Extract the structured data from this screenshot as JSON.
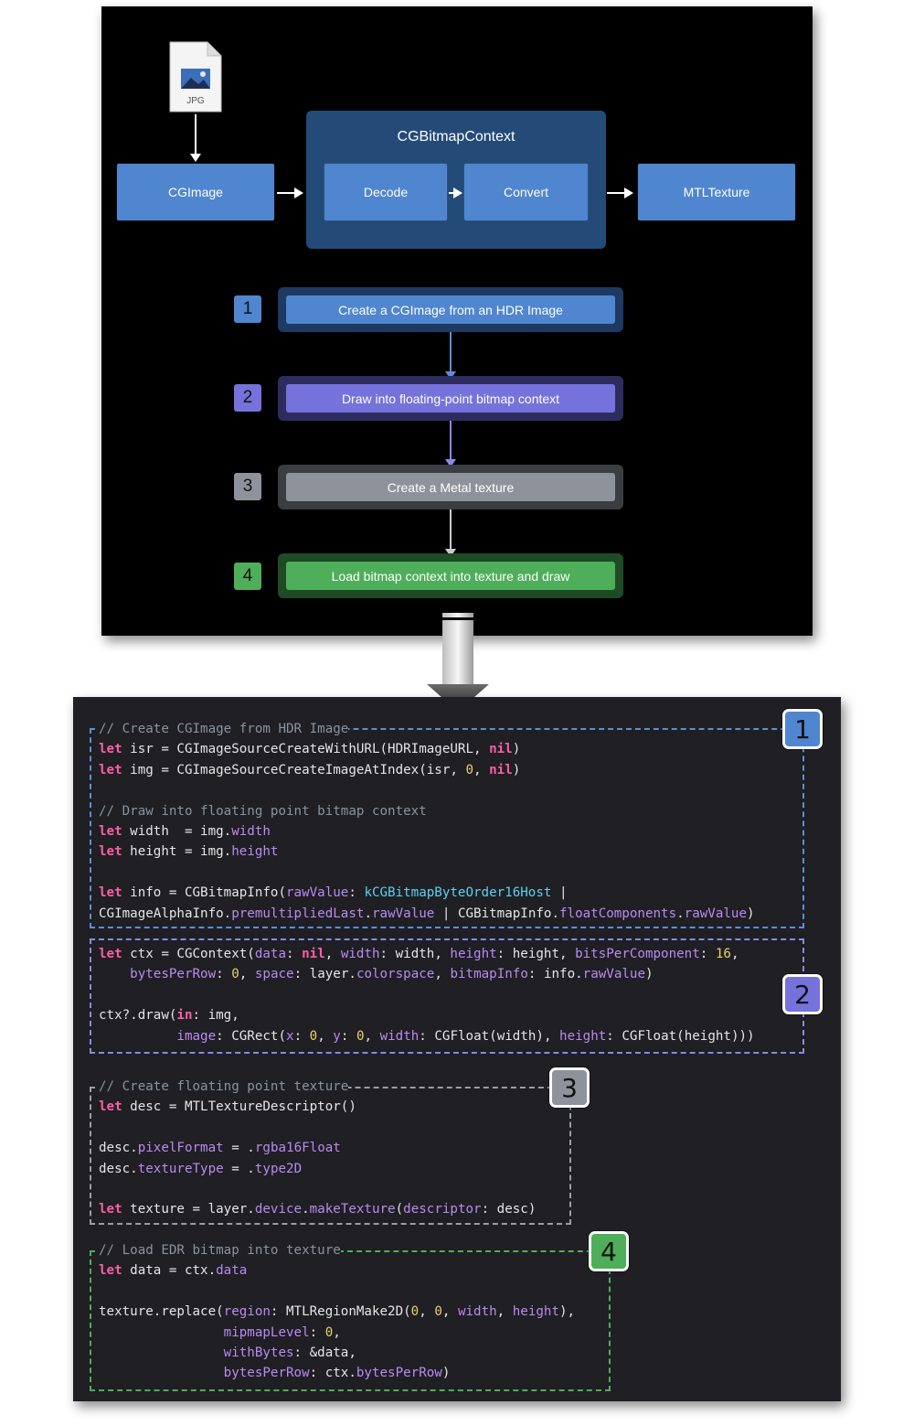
{
  "diagram": {
    "file_icon_label": "JPG",
    "cgimage": "CGImage",
    "context_title": "CGBitmapContext",
    "decode": "Decode",
    "convert": "Convert",
    "mtltexture": "MTLTexture",
    "steps": [
      {
        "num": "1",
        "label": "Create a CGImage from an HDR Image",
        "color": "#4f86cf"
      },
      {
        "num": "2",
        "label": "Draw into floating-point bitmap context",
        "color": "#7572dc"
      },
      {
        "num": "3",
        "label": "Create a Metal texture",
        "color": "#8e939b"
      },
      {
        "num": "4",
        "label": "Load bitmap context into texture and draw",
        "color": "#4fae59"
      }
    ]
  },
  "code": {
    "badges": [
      "1",
      "2",
      "3",
      "4"
    ],
    "section1": {
      "comment1": "// Create CGImage from HDR Image",
      "comment2": "// Draw into floating point bitmap context"
    },
    "section3": {
      "comment": "// Create floating point texture"
    },
    "section4": {
      "comment": "// Load EDR bitmap into texture"
    }
  },
  "colors": {
    "blue": "#4f86cf",
    "purple": "#7572dc",
    "gray": "#8e939b",
    "green": "#4fae59"
  }
}
